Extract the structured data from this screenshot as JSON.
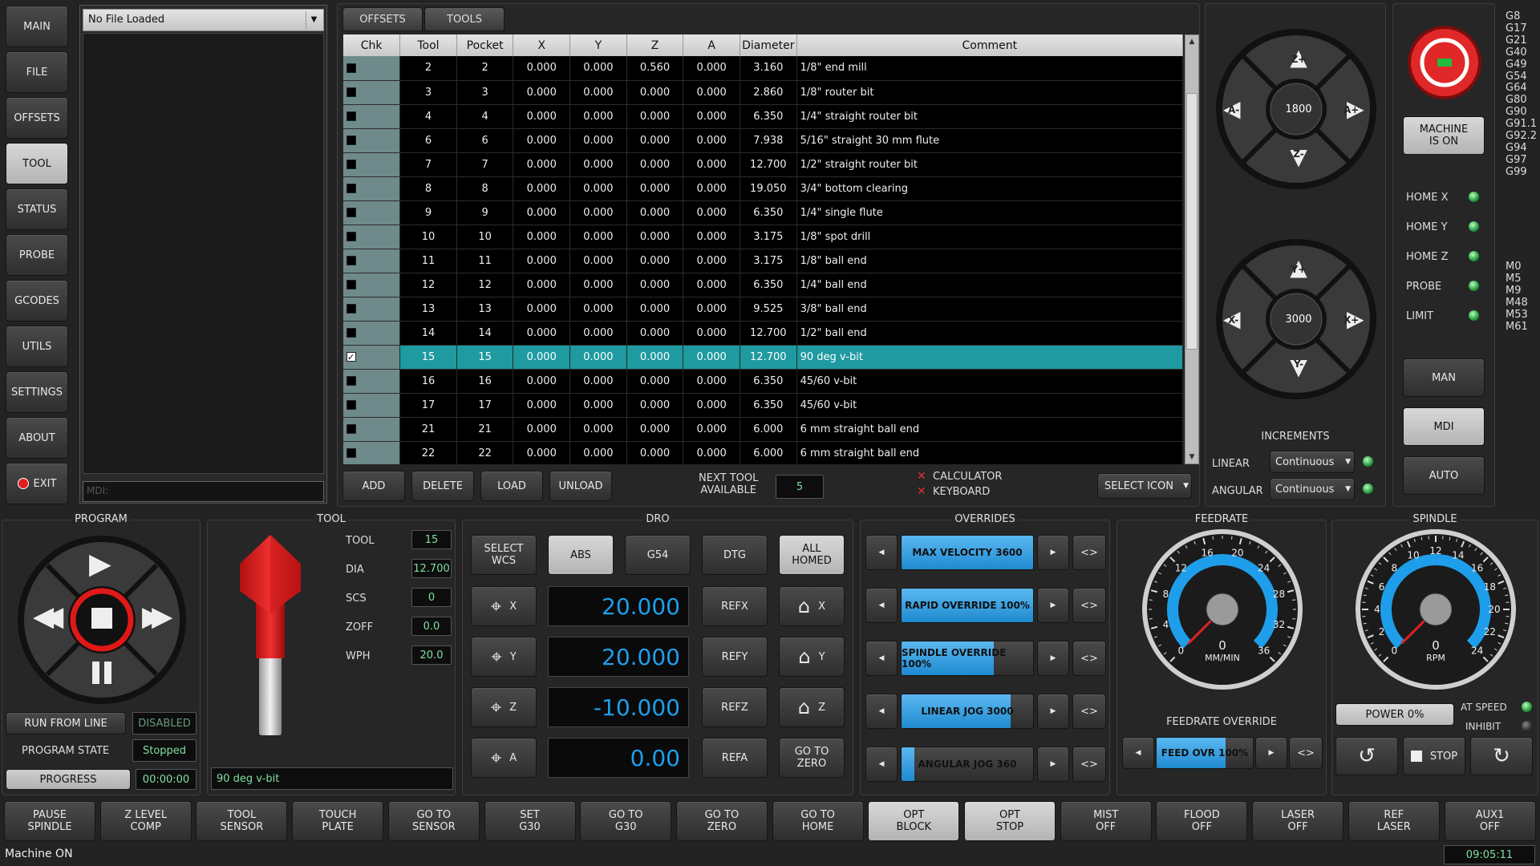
{
  "nav": [
    "MAIN",
    "FILE",
    "OFFSETS",
    "TOOL",
    "STATUS",
    "PROBE",
    "GCODES",
    "UTILS",
    "SETTINGS",
    "ABOUT",
    "EXIT"
  ],
  "file": {
    "loaded": "No File Loaded",
    "mdi_placeholder": "MDI:"
  },
  "tabs": [
    "OFFSETS",
    "TOOLS"
  ],
  "table": {
    "headers": [
      "Chk",
      "Tool",
      "Pocket",
      "X",
      "Y",
      "Z",
      "A",
      "Diameter",
      "Comment"
    ],
    "rows": [
      {
        "chk": false,
        "tool": "2",
        "pocket": "2",
        "x": "0.000",
        "y": "0.000",
        "z": "0.560",
        "a": "0.000",
        "dia": "3.160",
        "comment": "1/8\" end mill"
      },
      {
        "chk": false,
        "tool": "3",
        "pocket": "3",
        "x": "0.000",
        "y": "0.000",
        "z": "0.000",
        "a": "0.000",
        "dia": "2.860",
        "comment": "1/8\" router bit"
      },
      {
        "chk": false,
        "tool": "4",
        "pocket": "4",
        "x": "0.000",
        "y": "0.000",
        "z": "0.000",
        "a": "0.000",
        "dia": "6.350",
        "comment": "1/4\" straight router bit"
      },
      {
        "chk": false,
        "tool": "6",
        "pocket": "6",
        "x": "0.000",
        "y": "0.000",
        "z": "0.000",
        "a": "0.000",
        "dia": "7.938",
        "comment": "5/16\" straight 30 mm flute"
      },
      {
        "chk": false,
        "tool": "7",
        "pocket": "7",
        "x": "0.000",
        "y": "0.000",
        "z": "0.000",
        "a": "0.000",
        "dia": "12.700",
        "comment": "1/2\" straight router bit"
      },
      {
        "chk": false,
        "tool": "8",
        "pocket": "8",
        "x": "0.000",
        "y": "0.000",
        "z": "0.000",
        "a": "0.000",
        "dia": "19.050",
        "comment": "3/4\" bottom clearing"
      },
      {
        "chk": false,
        "tool": "9",
        "pocket": "9",
        "x": "0.000",
        "y": "0.000",
        "z": "0.000",
        "a": "0.000",
        "dia": "6.350",
        "comment": "1/4\" single flute"
      },
      {
        "chk": false,
        "tool": "10",
        "pocket": "10",
        "x": "0.000",
        "y": "0.000",
        "z": "0.000",
        "a": "0.000",
        "dia": "3.175",
        "comment": "1/8\" spot drill"
      },
      {
        "chk": false,
        "tool": "11",
        "pocket": "11",
        "x": "0.000",
        "y": "0.000",
        "z": "0.000",
        "a": "0.000",
        "dia": "3.175",
        "comment": "1/8\" ball end"
      },
      {
        "chk": false,
        "tool": "12",
        "pocket": "12",
        "x": "0.000",
        "y": "0.000",
        "z": "0.000",
        "a": "0.000",
        "dia": "6.350",
        "comment": "1/4\" ball end"
      },
      {
        "chk": false,
        "tool": "13",
        "pocket": "13",
        "x": "0.000",
        "y": "0.000",
        "z": "0.000",
        "a": "0.000",
        "dia": "9.525",
        "comment": "3/8\" ball end"
      },
      {
        "chk": false,
        "tool": "14",
        "pocket": "14",
        "x": "0.000",
        "y": "0.000",
        "z": "0.000",
        "a": "0.000",
        "dia": "12.700",
        "comment": "1/2\" ball end"
      },
      {
        "chk": true,
        "tool": "15",
        "pocket": "15",
        "x": "0.000",
        "y": "0.000",
        "z": "0.000",
        "a": "0.000",
        "dia": "12.700",
        "comment": "90 deg v-bit",
        "selected": true
      },
      {
        "chk": false,
        "tool": "16",
        "pocket": "16",
        "x": "0.000",
        "y": "0.000",
        "z": "0.000",
        "a": "0.000",
        "dia": "6.350",
        "comment": "45/60 v-bit"
      },
      {
        "chk": false,
        "tool": "17",
        "pocket": "17",
        "x": "0.000",
        "y": "0.000",
        "z": "0.000",
        "a": "0.000",
        "dia": "6.350",
        "comment": "45/60 v-bit"
      },
      {
        "chk": false,
        "tool": "21",
        "pocket": "21",
        "x": "0.000",
        "y": "0.000",
        "z": "0.000",
        "a": "0.000",
        "dia": "6.000",
        "comment": "6 mm straight ball end"
      },
      {
        "chk": false,
        "tool": "22",
        "pocket": "22",
        "x": "0.000",
        "y": "0.000",
        "z": "0.000",
        "a": "0.000",
        "dia": "6.000",
        "comment": "6 mm straight ball end"
      }
    ]
  },
  "toolbar": {
    "add": "ADD",
    "delete": "DELETE",
    "load": "LOAD",
    "unload": "UNLOAD",
    "next_tool_label": "NEXT TOOL\nAVAILABLE",
    "next_tool": "5",
    "calculator": "CALCULATOR",
    "keyboard": "KEYBOARD",
    "select_icon": "SELECT ICON"
  },
  "jog": {
    "z_speed": "1800",
    "xy_speed": "3000",
    "z_plus": "Z+",
    "z_minus": "Z-",
    "a_minus": "A-",
    "a_plus": "A+",
    "y_plus": "Y+",
    "y_minus": "Y-",
    "x_minus": "X-",
    "x_plus": "X+"
  },
  "increments": {
    "title": "INCREMENTS",
    "linear_label": "LINEAR",
    "linear": "Continuous",
    "angular_label": "ANGULAR",
    "angular": "Continuous"
  },
  "machine": {
    "state": "MACHINE\nIS ON",
    "home_x": "HOME X",
    "home_y": "HOME Y",
    "home_z": "HOME Z",
    "probe": "PROBE",
    "limit": "LIMIT",
    "man": "MAN",
    "mdi": "MDI",
    "auto": "AUTO"
  },
  "gcodes": [
    "G8",
    "G17",
    "G21",
    "G40",
    "G49",
    "G54",
    "G64",
    "G80",
    "G90",
    "G91.1",
    "G92.2",
    "G94",
    "G97",
    "G99"
  ],
  "mcodes": [
    "M0",
    "M5",
    "M9",
    "M48",
    "M53",
    "M61"
  ],
  "program": {
    "title": "PROGRAM",
    "run_from_line": "RUN FROM LINE",
    "disabled": "DISABLED",
    "state_label": "PROGRAM STATE",
    "state": "Stopped",
    "progress_label": "PROGRESS",
    "time": "00:00:00"
  },
  "tool": {
    "title": "TOOL",
    "tool_label": "TOOL",
    "tool": "15",
    "dia_label": "DIA",
    "dia": "12.700",
    "scs_label": "SCS",
    "scs": "0",
    "zoff_label": "ZOFF",
    "zoff": "0.0",
    "wph_label": "WPH",
    "wph": "20.0",
    "comment": "90 deg v-bit"
  },
  "dro": {
    "title": "DRO",
    "select_wcs": "SELECT\nWCS",
    "abs": "ABS",
    "g54": "G54",
    "dtg": "DTG",
    "all_homed": "ALL\nHOMED",
    "x": "20.000",
    "y": "20.000",
    "z": "-10.000",
    "a": "0.00",
    "refx": "REFX",
    "refy": "REFY",
    "refz": "REFZ",
    "refa": "REFA",
    "go_to_zero": "GO TO\nZERO",
    "axis_x": "X",
    "axis_y": "Y",
    "axis_z": "Z",
    "axis_a": "A"
  },
  "overrides": {
    "title": "OVERRIDES",
    "items": [
      {
        "label": "MAX VELOCITY 3600",
        "fill": 1.0
      },
      {
        "label": "RAPID OVERRIDE 100%",
        "fill": 1.0
      },
      {
        "label": "SPINDLE  OVERRIDE 100%",
        "fill": 0.7
      },
      {
        "label": "LINEAR JOG 3000",
        "fill": 0.83
      },
      {
        "label": "ANGULAR JOG 360",
        "fill": 0.1
      }
    ],
    "arrow": "<>"
  },
  "feedrate": {
    "title": "FEEDRATE",
    "value": "0",
    "unit": "MM/MIN",
    "ticks": [
      "0",
      "4",
      "8",
      "12",
      "16",
      "20",
      "24",
      "28",
      "32",
      "36"
    ],
    "override_label": "FEEDRATE OVERRIDE",
    "ovr": "FEED OVR 100%",
    "ovr_fill": 0.72
  },
  "spindle": {
    "title": "SPINDLE",
    "value": "0",
    "unit": "RPM",
    "ticks": [
      "0",
      "2",
      "4",
      "6",
      "8",
      "10",
      "12",
      "14",
      "16",
      "18",
      "20",
      "22",
      "24"
    ],
    "power": "POWER 0%",
    "at_speed": "AT SPEED",
    "inhibit": "INHIBIT",
    "stop": "STOP"
  },
  "bottom": [
    "PAUSE\nSPINDLE",
    "Z LEVEL\nCOMP",
    "TOOL\nSENSOR",
    "TOUCH\nPLATE",
    "GO TO\nSENSOR",
    "SET\nG30",
    "GO TO\nG30",
    "GO TO\nZERO",
    "GO TO\nHOME",
    "OPT\nBLOCK",
    "OPT\nSTOP",
    "MIST\nOFF",
    "FLOOD\nOFF",
    "LASER\nOFF",
    "REF\nLASER",
    "AUX1\nOFF"
  ],
  "status": {
    "text": "Machine ON",
    "clock": "09:05:11"
  },
  "colors": {
    "accent": "#1e9aa0",
    "dro": "#1e9eea",
    "gauge": "#1e9eea",
    "estop": "#e02020"
  }
}
